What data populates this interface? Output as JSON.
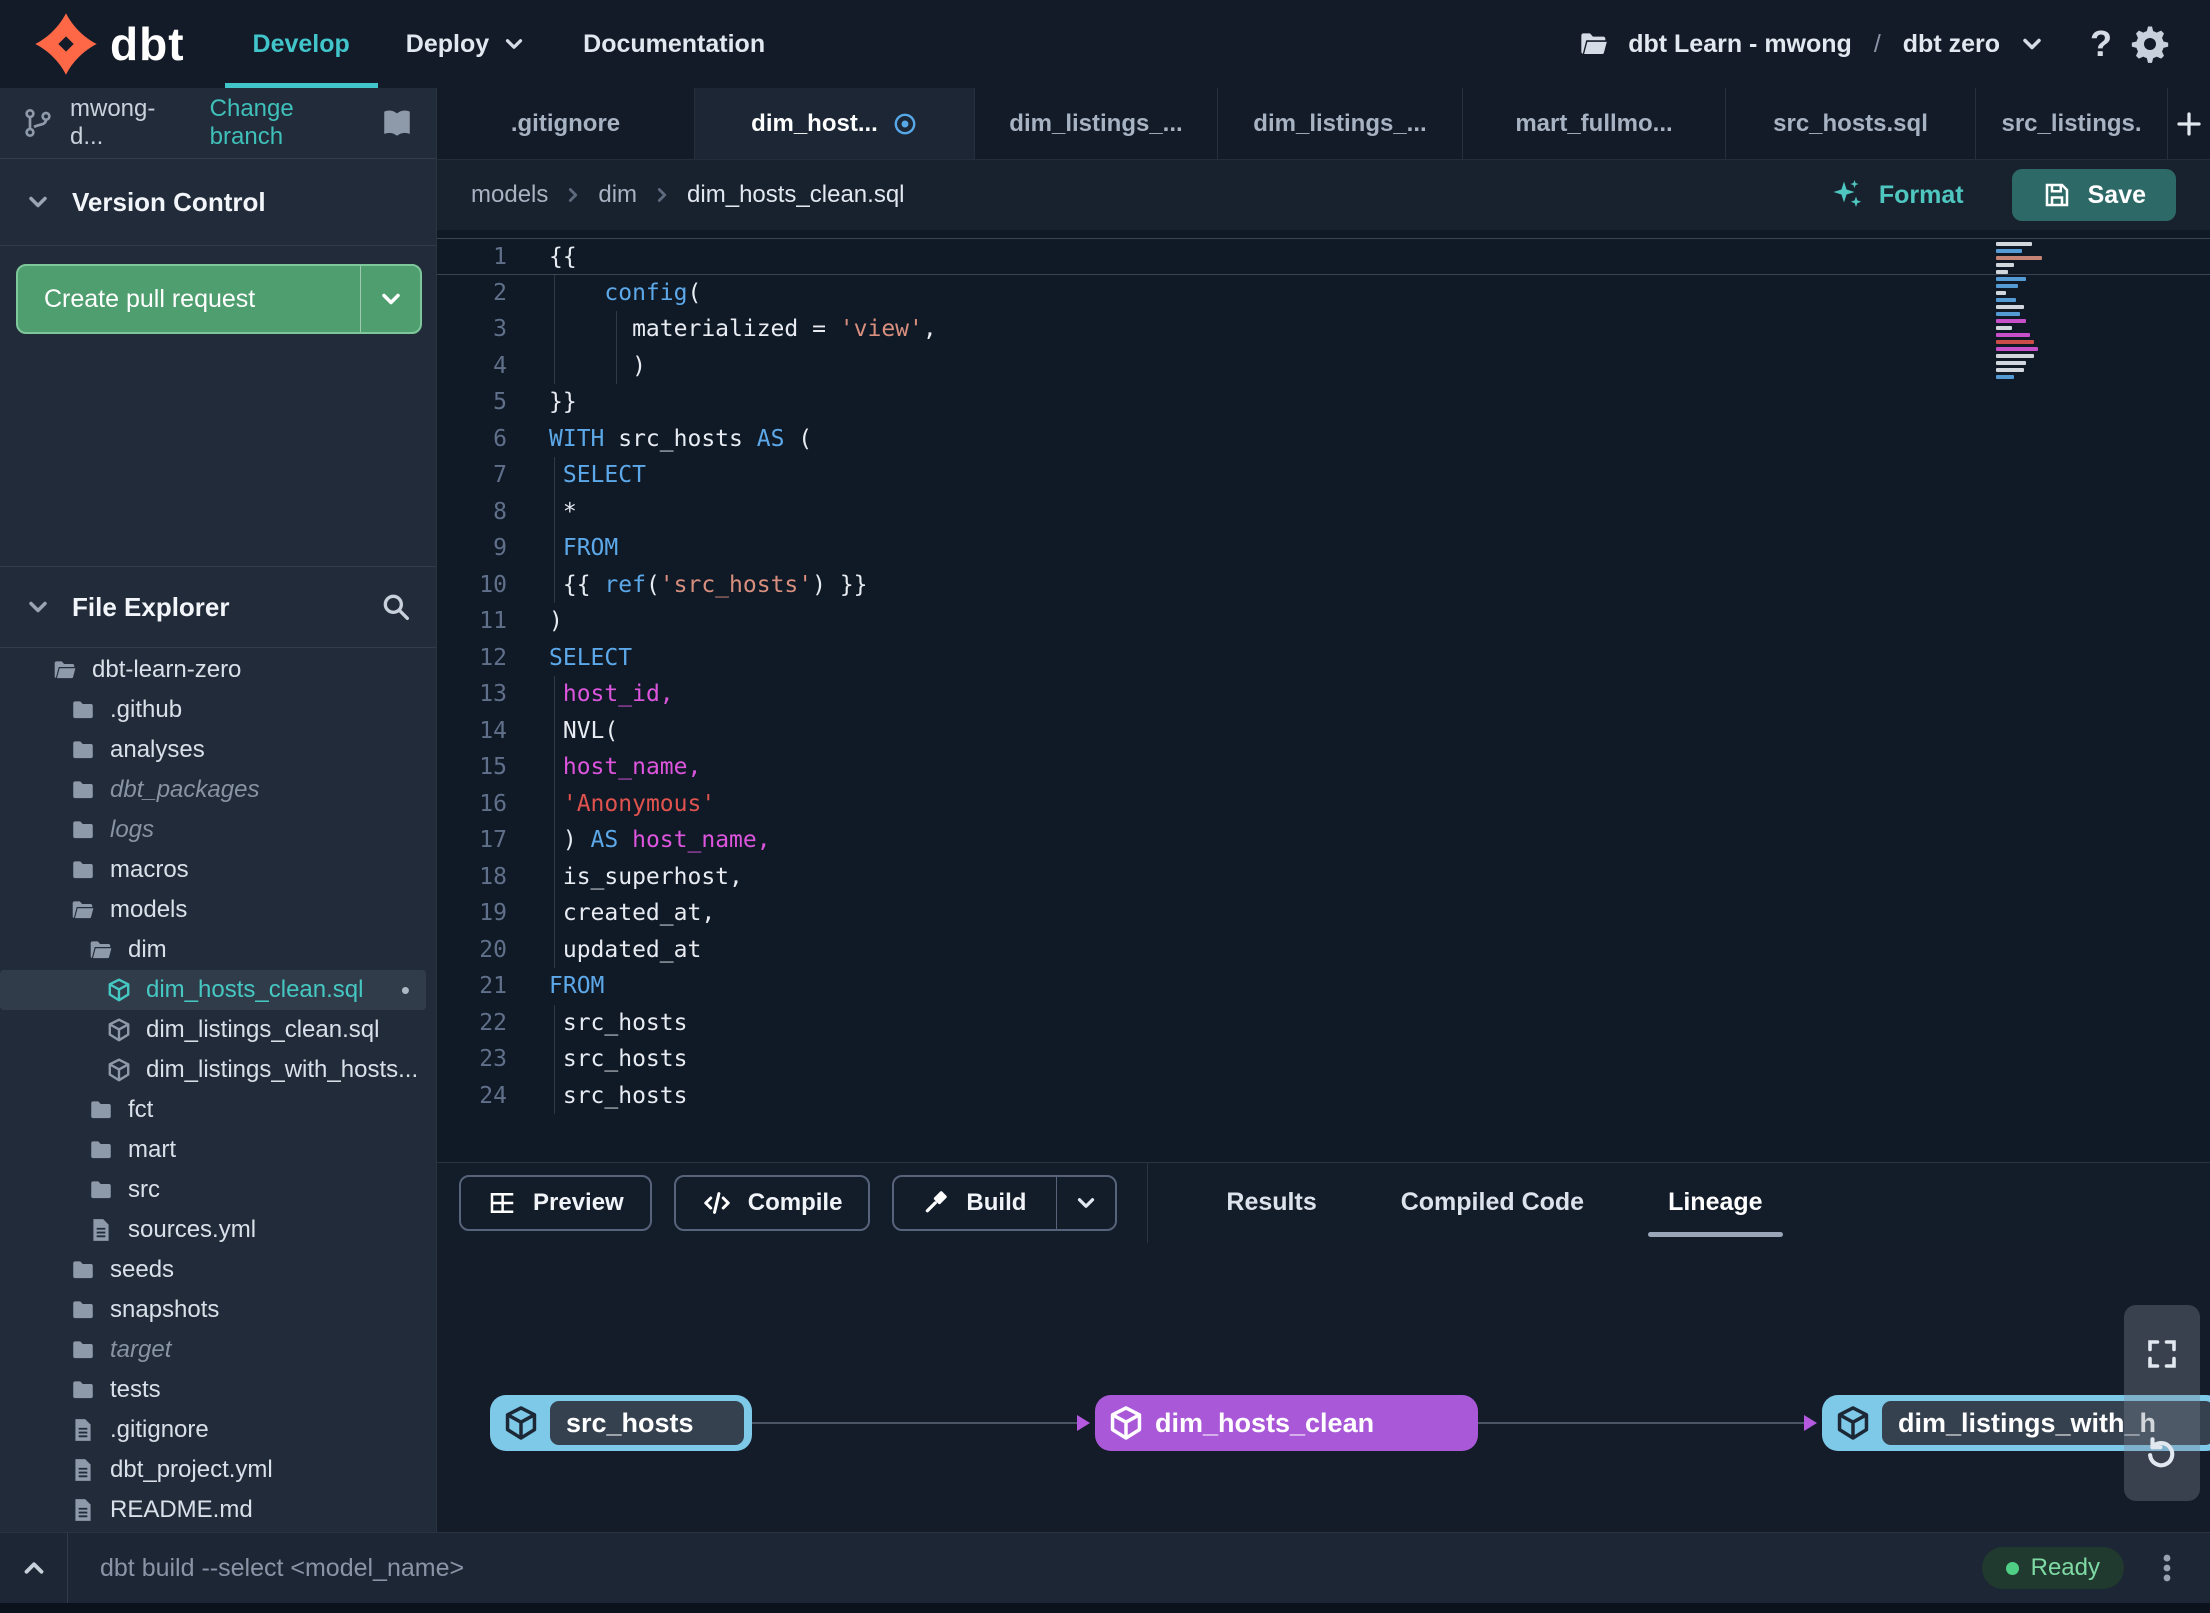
{
  "app": {
    "brand": "dbt"
  },
  "nav": {
    "items": [
      {
        "label": "Develop",
        "active": true,
        "caret": false
      },
      {
        "label": "Deploy",
        "active": false,
        "caret": true
      },
      {
        "label": "Documentation",
        "active": false,
        "caret": false
      }
    ],
    "account": {
      "project": "dbt Learn - mwong",
      "separator": "/",
      "selection": "dbt zero"
    }
  },
  "icons": {
    "help_glyph": "?"
  },
  "sidebar": {
    "branch": {
      "name": "mwong-d...",
      "action": "Change branch"
    },
    "version_control": {
      "title": "Version Control",
      "create_pr": "Create pull request"
    },
    "file_explorer": {
      "title": "File Explorer",
      "tree": [
        {
          "label": "dbt-learn-zero",
          "icon": "folderOpen",
          "level": 0
        },
        {
          "label": ".github",
          "icon": "folder",
          "level": 1
        },
        {
          "label": "analyses",
          "icon": "folder",
          "level": 1
        },
        {
          "label": "dbt_packages",
          "icon": "folder",
          "level": 1,
          "italic": true
        },
        {
          "label": "logs",
          "icon": "folder",
          "level": 1,
          "italic": true
        },
        {
          "label": "macros",
          "icon": "folder",
          "level": 1
        },
        {
          "label": "models",
          "icon": "folderOpen",
          "level": 1
        },
        {
          "label": "dim",
          "icon": "folderOpen",
          "level": 2
        },
        {
          "label": "dim_hosts_clean.sql",
          "icon": "cube",
          "level": 3,
          "selected": true,
          "modified": true
        },
        {
          "label": "dim_listings_clean.sql",
          "icon": "cube",
          "level": 3
        },
        {
          "label": "dim_listings_with_hosts...",
          "icon": "cube",
          "level": 3
        },
        {
          "label": "fct",
          "icon": "folder",
          "level": 2
        },
        {
          "label": "mart",
          "icon": "folder",
          "level": 2
        },
        {
          "label": "src",
          "icon": "folder",
          "level": 2
        },
        {
          "label": "sources.yml",
          "icon": "file",
          "level": 2
        },
        {
          "label": "seeds",
          "icon": "folder",
          "level": 1
        },
        {
          "label": "snapshots",
          "icon": "folder",
          "level": 1
        },
        {
          "label": "target",
          "icon": "folder",
          "level": 1,
          "italic": true
        },
        {
          "label": "tests",
          "icon": "folder",
          "level": 1
        },
        {
          "label": ".gitignore",
          "icon": "file",
          "level": 1
        },
        {
          "label": "dbt_project.yml",
          "icon": "file",
          "level": 1
        },
        {
          "label": "README.md",
          "icon": "file",
          "level": 1
        }
      ]
    }
  },
  "tabs": {
    "items": [
      {
        "label": ".gitignore"
      },
      {
        "label": "dim_host...",
        "active": true,
        "modified": true
      },
      {
        "label": "dim_listings_..."
      },
      {
        "label": "dim_listings_..."
      },
      {
        "label": "mart_fullmo..."
      },
      {
        "label": "src_hosts.sql"
      },
      {
        "label": "src_listings."
      }
    ]
  },
  "breadcrumb": {
    "items": [
      "models",
      "dim",
      "dim_hosts_clean.sql"
    ]
  },
  "editor": {
    "format_label": "Format",
    "save_label": "Save",
    "lines": [
      {
        "n": 1,
        "active": true,
        "toks": [
          [
            "p",
            "{{"
          ]
        ]
      },
      {
        "n": 2,
        "toks": [
          [
            "p",
            "    "
          ],
          [
            "k",
            "config"
          ],
          [
            "p",
            "("
          ]
        ]
      },
      {
        "n": 3,
        "toks": [
          [
            "p",
            "      materialized = "
          ],
          [
            "s",
            "'view'"
          ],
          [
            "p",
            ","
          ]
        ]
      },
      {
        "n": 4,
        "toks": [
          [
            "p",
            "      )"
          ]
        ]
      },
      {
        "n": 5,
        "toks": [
          [
            "p",
            "}}"
          ]
        ]
      },
      {
        "n": 6,
        "toks": [
          [
            "k",
            "WITH"
          ],
          [
            "p",
            " src_hosts "
          ],
          [
            "k",
            "AS"
          ],
          [
            "p",
            " ("
          ]
        ]
      },
      {
        "n": 7,
        "toks": [
          [
            "p",
            " "
          ],
          [
            "k",
            "SELECT"
          ]
        ]
      },
      {
        "n": 8,
        "toks": [
          [
            "p",
            " *"
          ]
        ]
      },
      {
        "n": 9,
        "toks": [
          [
            "p",
            " "
          ],
          [
            "k",
            "FROM"
          ]
        ]
      },
      {
        "n": 10,
        "toks": [
          [
            "p",
            " {{ "
          ],
          [
            "k",
            "ref"
          ],
          [
            "p",
            "("
          ],
          [
            "s",
            "'src_hosts'"
          ],
          [
            "p",
            ") }}"
          ]
        ]
      },
      {
        "n": 11,
        "toks": [
          [
            "p",
            ")"
          ]
        ]
      },
      {
        "n": 12,
        "toks": [
          [
            "k",
            "SELECT"
          ]
        ]
      },
      {
        "n": 13,
        "toks": [
          [
            "p",
            " "
          ],
          [
            "m",
            "host_id,"
          ]
        ]
      },
      {
        "n": 14,
        "toks": [
          [
            "p",
            " NVL("
          ]
        ]
      },
      {
        "n": 15,
        "toks": [
          [
            "p",
            " "
          ],
          [
            "m",
            "host_name,"
          ]
        ]
      },
      {
        "n": 16,
        "toks": [
          [
            "p",
            " "
          ],
          [
            "r",
            "'Anonymous'"
          ]
        ]
      },
      {
        "n": 17,
        "toks": [
          [
            "p",
            " ) "
          ],
          [
            "k",
            "AS"
          ],
          [
            "p",
            " "
          ],
          [
            "m",
            "host_name,"
          ]
        ]
      },
      {
        "n": 18,
        "toks": [
          [
            "p",
            " is_superhost,"
          ]
        ]
      },
      {
        "n": 19,
        "toks": [
          [
            "p",
            " created_at,"
          ]
        ]
      },
      {
        "n": 20,
        "toks": [
          [
            "p",
            " updated_at"
          ]
        ]
      },
      {
        "n": 21,
        "toks": [
          [
            "k",
            "FROM"
          ]
        ]
      },
      {
        "n": 22,
        "toks": [
          [
            "p",
            " src_hosts"
          ]
        ]
      },
      {
        "n": 23,
        "toks": [
          [
            "p",
            " src_hosts"
          ]
        ]
      },
      {
        "n": 24,
        "toks": [
          [
            "p",
            " src_hosts"
          ]
        ]
      }
    ]
  },
  "bottom_panel": {
    "buttons": [
      {
        "label": "Preview",
        "icon": "grid"
      },
      {
        "label": "Compile",
        "icon": "code"
      },
      {
        "label": "Build",
        "icon": "hammer",
        "split": true
      }
    ],
    "tabs": [
      {
        "label": "Results"
      },
      {
        "label": "Compiled Code"
      },
      {
        "label": "Lineage",
        "active": true
      }
    ]
  },
  "lineage": {
    "nodes": [
      {
        "label": "src_hosts",
        "kind": "source"
      },
      {
        "label": "dim_hosts_clean",
        "kind": "model"
      },
      {
        "label": "dim_listings_with_h",
        "kind": "source"
      }
    ]
  },
  "status_bar": {
    "command": "dbt build --select <model_name>",
    "status": "Ready"
  },
  "colors": {
    "accent_teal": "#41C4CA",
    "brand_orange": "#FF6847",
    "node_blue": "#7EC8E8",
    "node_purple": "#A958D8",
    "keyword_blue": "#5CA8E8",
    "string_salmon": "#D98F7D",
    "string_red": "#E0524E",
    "identifier_magenta": "#DD55DD",
    "create_pr_green": "#4F9E6F",
    "save_teal": "#2D6A67",
    "ready_green": "#4FCE85"
  }
}
